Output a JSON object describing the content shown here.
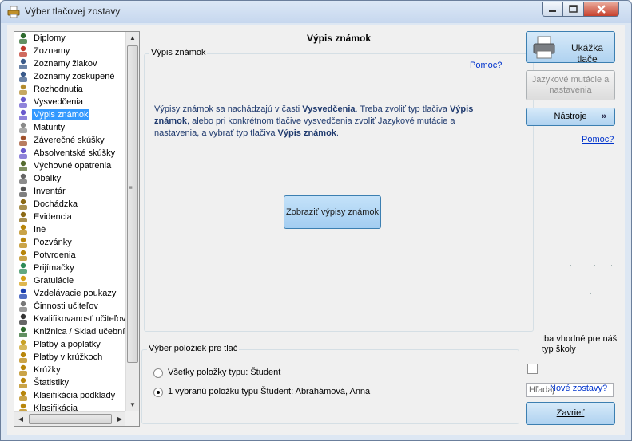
{
  "window": {
    "title": "Výber tlačovej zostavy"
  },
  "sidebar": {
    "items": [
      {
        "label": "Diplomy",
        "icon": "diploma-icon"
      },
      {
        "label": "Zoznamy",
        "icon": "house-icon"
      },
      {
        "label": "Zoznamy žiakov",
        "icon": "students-icon"
      },
      {
        "label": "Zoznamy zoskupené",
        "icon": "students-group-icon"
      },
      {
        "label": "Rozhodnutia",
        "icon": "decision-icon"
      },
      {
        "label": "Vysvedčenia",
        "icon": "certificate-icon"
      },
      {
        "label": "Výpis známok",
        "icon": "grades-icon"
      },
      {
        "label": "Maturity",
        "icon": "trophy-icon"
      },
      {
        "label": "Záverečné skúšky",
        "icon": "book-icon"
      },
      {
        "label": "Absolventské skúšky",
        "icon": "certificate-icon"
      },
      {
        "label": "Výchovné opatrenia",
        "icon": "measures-icon"
      },
      {
        "label": "Obálky",
        "icon": "envelope-icon"
      },
      {
        "label": "Inventár",
        "icon": "inventory-icon"
      },
      {
        "label": "Dochádzka",
        "icon": "attendance-icon"
      },
      {
        "label": "Evidencia",
        "icon": "records-icon"
      },
      {
        "label": "Iné",
        "icon": "person-icon"
      },
      {
        "label": "Pozvánky",
        "icon": "person-icon"
      },
      {
        "label": "Potvrdenia",
        "icon": "person-icon"
      },
      {
        "label": "Prijímačky",
        "icon": "person-add-icon"
      },
      {
        "label": "Gratulácie",
        "icon": "gift-icon"
      },
      {
        "label": "Vzdelávacie poukazy",
        "icon": "checkmark-icon"
      },
      {
        "label": "Činnosti učiteľov",
        "icon": "document-icon"
      },
      {
        "label": "Kvalifikovanosť učiteľov",
        "icon": "teacher-icon"
      },
      {
        "label": "Knižnica / Sklad učebníc",
        "icon": "books-icon"
      },
      {
        "label": "Platby a poplatky",
        "icon": "money-icon"
      },
      {
        "label": "Platby v krúžkoch",
        "icon": "person-icon"
      },
      {
        "label": "Krúžky",
        "icon": "person-icon"
      },
      {
        "label": "Štatistiky",
        "icon": "person-icon"
      },
      {
        "label": "Klasifikácia podklady",
        "icon": "person-icon"
      },
      {
        "label": "Klasifikácia",
        "icon": "person-icon"
      }
    ],
    "selected_index": 6
  },
  "main": {
    "title": "Výpis známok",
    "group_title": "Výpis známok",
    "help_link": "Pomoc?",
    "info": {
      "p1": "Výpisy známok sa nachádzajú v časti ",
      "b1": "Vysvedčenia",
      "p2": ". Treba zvoliť typ tlačiva ",
      "b2": "Výpis známok",
      "p3": ", alebo pri konkrétnom tlačive vysvedčenia zvoliť Jazykové mutácie a nastavenia, a vybrať typ tlačiva ",
      "b3": "Výpis známok",
      "p4": "."
    },
    "show_button": "Zobraziť výpisy známok"
  },
  "selection": {
    "group_title": "Výber položiek pre tlač",
    "options": [
      {
        "label": "Všetky položky typu: Študent",
        "checked": false
      },
      {
        "label": "1 vybranú položku typu Študent: Abrahámová, Anna",
        "checked": true
      }
    ]
  },
  "right": {
    "preview_button": "Ukážka tlače",
    "lang_button": "Jazykové mutácie a nastavenia",
    "tools_button": "Nástroje",
    "help_link": "Pomoc?",
    "checkbox_label": "Iba vhodné pre náš typ školy",
    "search_placeholder": "Hľadaj",
    "new_link": "Nové zostavy?",
    "close_button": "Zavrieť"
  },
  "colors": {
    "selected": "#3399ff",
    "info_text": "#1f3a6e",
    "link": "#0033cc"
  }
}
